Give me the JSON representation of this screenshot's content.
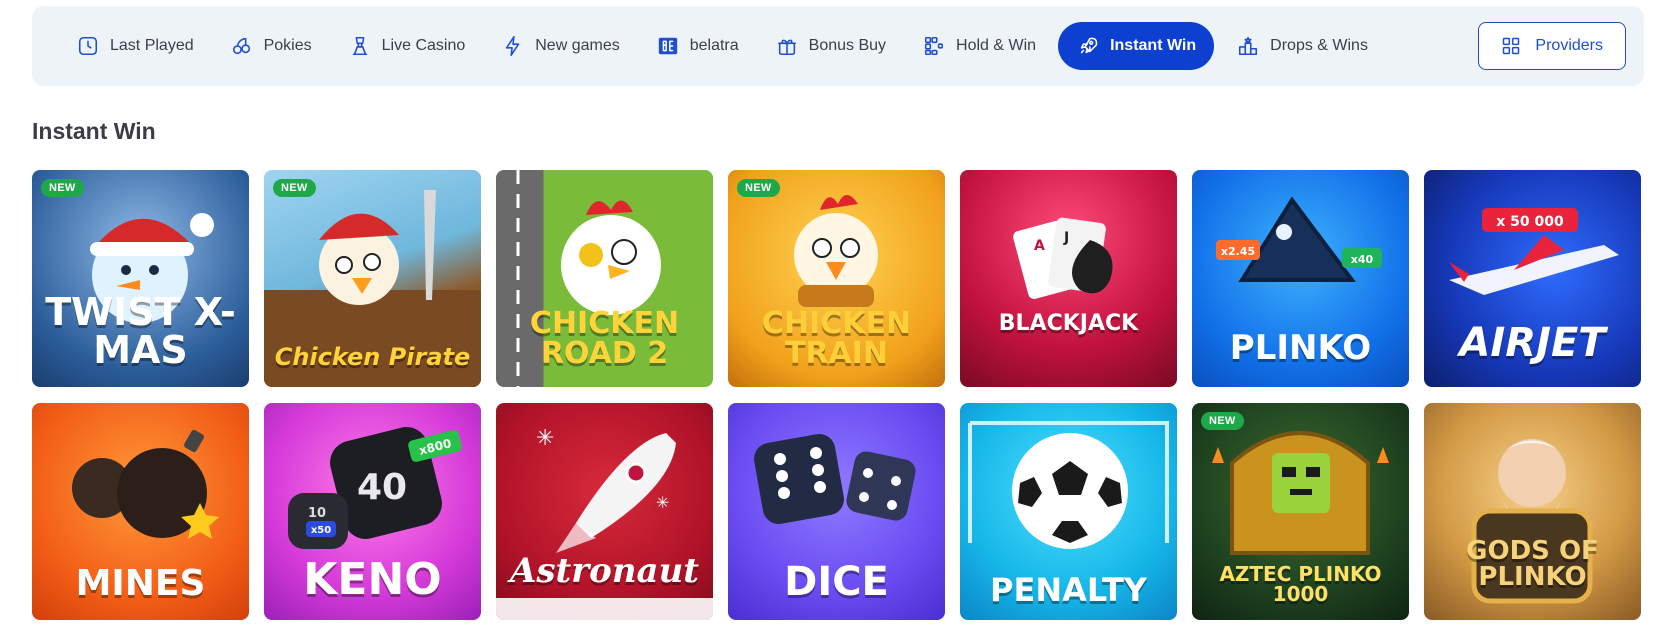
{
  "nav": {
    "categories": [
      {
        "label": "Last Played",
        "icon": "clock-icon"
      },
      {
        "label": "Pokies",
        "icon": "cherries-icon"
      },
      {
        "label": "Live Casino",
        "icon": "dealer-icon"
      },
      {
        "label": "New games",
        "icon": "lightning-icon"
      },
      {
        "label": "belatra",
        "icon": "belatra-logo-icon"
      },
      {
        "label": "Bonus Buy",
        "icon": "gift-icon"
      },
      {
        "label": "Hold & Win",
        "icon": "grid-dots-icon"
      },
      {
        "label": "Instant Win",
        "icon": "rocket-icon"
      },
      {
        "label": "Drops & Wins",
        "icon": "podium-icon"
      }
    ],
    "active": "Instant Win",
    "providers_label": "Providers"
  },
  "section": {
    "title": "Instant Win"
  },
  "games": [
    {
      "name": "TWIST X-MAS",
      "badge": "NEW"
    },
    {
      "name": "Chicken Pirate",
      "badge": "NEW"
    },
    {
      "name": "CHICKEN ROAD 2",
      "badge": ""
    },
    {
      "name": "CHICKEN TRAIN",
      "badge": "NEW"
    },
    {
      "name": "BLACKJACK",
      "badge": ""
    },
    {
      "name": "PLINKO",
      "badge": "",
      "tags": [
        "x2.45",
        "x40"
      ]
    },
    {
      "name": "AIRJET",
      "badge": "",
      "tags": [
        "x 50 000"
      ]
    },
    {
      "name": "MINES",
      "badge": ""
    },
    {
      "name": "KENO",
      "badge": "",
      "tags": [
        "x800",
        "40",
        "10",
        "x50"
      ]
    },
    {
      "name": "Astronaut",
      "badge": ""
    },
    {
      "name": "DICE",
      "badge": ""
    },
    {
      "name": "PENALTY",
      "badge": ""
    },
    {
      "name": "AZTEC PLINKO 1000",
      "badge": "NEW"
    },
    {
      "name": "GODS OF PLINKO",
      "badge": ""
    }
  ],
  "colors": {
    "accent": "#0d3fd0",
    "bar_bg": "#eef3f8",
    "badge_green": "#1ea84a"
  }
}
